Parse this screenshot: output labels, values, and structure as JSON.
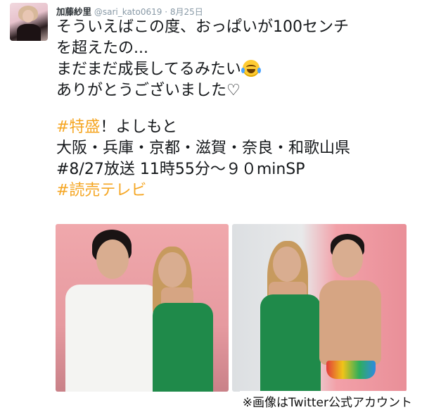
{
  "tweet": {
    "author_name": "加藤紗里",
    "author_handle": "@sari_kato0619",
    "separator": "·",
    "date": "8月25日",
    "lines": [
      "そういえばこの度、おっぱいが100センチ",
      "を超えたの...",
      "まだまだ成長してるみたい",
      "ありがとうございました♡"
    ],
    "hashtag_tokusei": "#特盛",
    "line_yoshimoto_rest": "！よしもと",
    "line_areas": "大阪・兵庫・京都・滋賀・奈良・和歌山県",
    "line_broadcast": "#8/27放送 11時55分～９０minSP",
    "hashtag_yomiuri": "#読売テレビ",
    "emoji": "crying-laughing-face-icon"
  },
  "caption": "※画像はTwitter公式アカウント",
  "colors": {
    "hashtag": "#f5a623",
    "text": "#14171a",
    "meta": "#8899a6"
  }
}
